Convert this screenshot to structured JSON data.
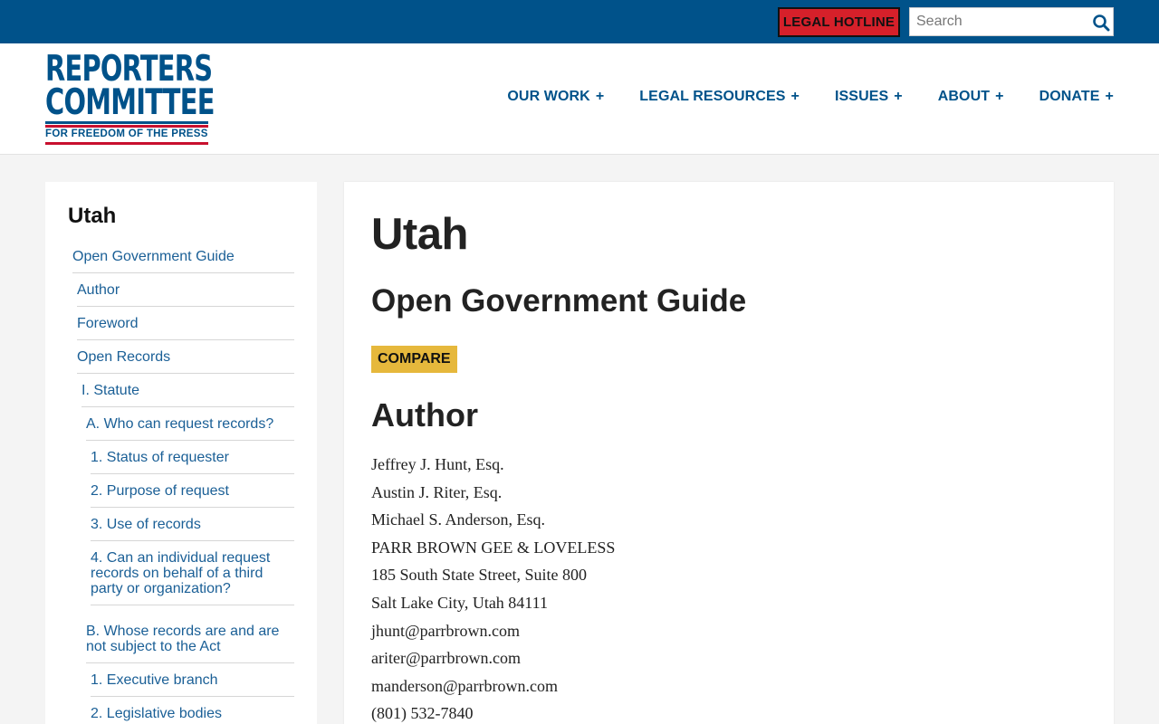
{
  "topbar": {
    "hotline_label": "LEGAL HOTLINE",
    "search_placeholder": "Search",
    "background_color": "#00528a",
    "hotline_color": "#d6202a"
  },
  "logo": {
    "line1": "REPORTERS",
    "line2": "COMMITTEE",
    "tagline": "FOR FREEDOM OF THE PRESS"
  },
  "nav": {
    "items": [
      {
        "label": "OUR WORK",
        "expand": "+"
      },
      {
        "label": "LEGAL RESOURCES",
        "expand": "+"
      },
      {
        "label": "ISSUES",
        "expand": "+"
      },
      {
        "label": "ABOUT",
        "expand": "+"
      },
      {
        "label": "DONATE",
        "expand": "+"
      }
    ]
  },
  "sidebar": {
    "title": "Utah",
    "items": [
      {
        "label": "Open Government Guide"
      },
      {
        "label": "Author"
      },
      {
        "label": "Foreword"
      },
      {
        "label": "Open Records"
      },
      {
        "label": "I. Statute"
      },
      {
        "label": "A. Who can request records?"
      },
      {
        "label": "1. Status of requester"
      },
      {
        "label": "2. Purpose of request"
      },
      {
        "label": "3. Use of records"
      },
      {
        "label": "4. Can an individual request records on behalf of a third party or organization?"
      },
      {
        "label": "B. Whose records are and are not subject to the Act"
      },
      {
        "label": "1. Executive branch"
      },
      {
        "label": "2. Legislative bodies"
      }
    ]
  },
  "main": {
    "title": "Utah",
    "subtitle": "Open Government Guide",
    "compare_label": "COMPARE",
    "section_heading": "Author",
    "author_lines": [
      "Jeffrey J. Hunt, Esq.",
      "Austin J. Riter, Esq.",
      "Michael S. Anderson, Esq.",
      "PARR BROWN GEE & LOVELESS",
      "185 South State Street, Suite 800",
      "Salt Lake City, Utah 84111",
      "jhunt@parrbrown.com",
      "ariter@parrbrown.com",
      "manderson@parrbrown.com",
      "(801) 532-7840"
    ],
    "compare_color": "#e6b83c"
  }
}
